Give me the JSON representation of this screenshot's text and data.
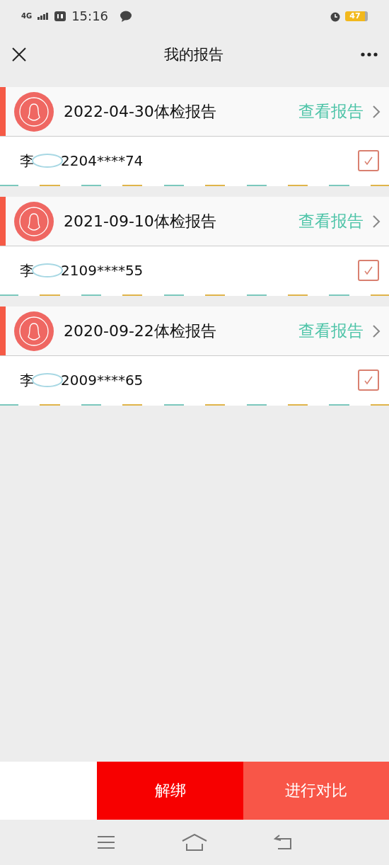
{
  "status_bar": {
    "network": "4G",
    "time": "15:16",
    "battery": "47"
  },
  "header": {
    "title": "我的报告"
  },
  "reports": [
    {
      "title": "2022-04-30体检报告",
      "action": "查看报告",
      "name_prefix": "李",
      "id_suffix": "2204****74",
      "checked": true
    },
    {
      "title": "2021-09-10体检报告",
      "action": "查看报告",
      "name_prefix": "李",
      "id_suffix": "2109****55",
      "checked": true
    },
    {
      "title": "2020-09-22体检报告",
      "action": "查看报告",
      "name_prefix": "李",
      "id_suffix": "2009****65",
      "checked": true
    }
  ],
  "footer": {
    "buttons": [
      {
        "label": "解绑",
        "kind": "unbind"
      },
      {
        "label": "进行对比",
        "kind": "compare"
      }
    ]
  }
}
